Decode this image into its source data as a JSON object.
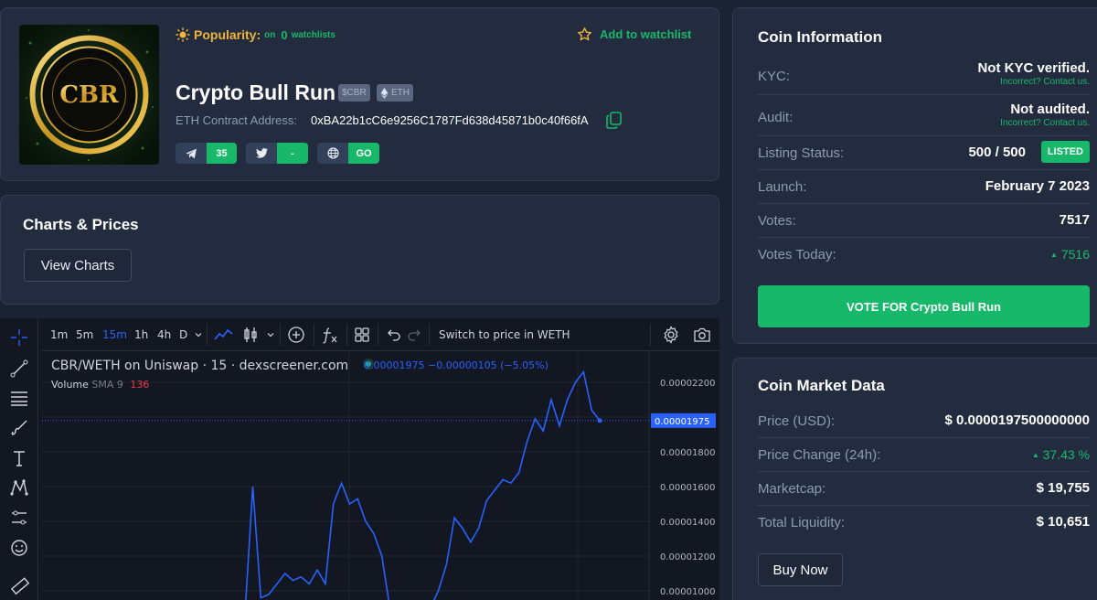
{
  "header": {
    "logo_text": "CBR",
    "logo_ring_text": "CRYPTO BULL RUN",
    "popularity_label": "Popularity:",
    "popularity_on": "on",
    "popularity_count": "0",
    "popularity_suffix": "watchlists",
    "watchlist_label": "Add to watchlist",
    "coin_name": "Crypto Bull Run",
    "symbol_tag": "$CBR",
    "chain_tag": "ETH",
    "contract_label": "ETH Contract Address:",
    "contract_address": "0xBA22b1cC6e9256C1787Fd638d45871b0c40f66fA",
    "socials": [
      {
        "icon": "telegram-icon",
        "value": "35"
      },
      {
        "icon": "twitter-icon",
        "value": "-"
      },
      {
        "icon": "globe-icon",
        "value": "GO"
      }
    ]
  },
  "charts_prices": {
    "title": "Charts & Prices",
    "button": "View Charts"
  },
  "chart_widget": {
    "intervals": [
      "1m",
      "5m",
      "15m",
      "1h",
      "4h",
      "D"
    ],
    "active_interval": "15m",
    "switch_label": "Switch to price in WETH",
    "symbol_line": "CBR/WETH on Uniswap · 15 · dexscreener.com",
    "price_line": "0.00001975 −0.00000105 (−5.05%)",
    "volume_label": "Volume",
    "volume_sma": "SMA 9",
    "volume_value": "136",
    "current_price_label": "0.00001975"
  },
  "chart_data": {
    "type": "line",
    "title": "CBR/WETH on Uniswap · 15 · dexscreener.com",
    "y_ticks": [
      "0.00002200",
      "0.00002000",
      "0.00001800",
      "0.00001600",
      "0.00001400",
      "0.00001200",
      "0.00001000"
    ],
    "ylim": [
      9.6e-06,
      2.32e-05
    ],
    "series": [
      {
        "values": [
          8e-06,
          8e-06,
          8e-06,
          1.6e-05,
          9.6e-06,
          9.8e-06,
          1.04e-05,
          1.1e-05,
          1.06e-05,
          1.08e-05,
          1.04e-05,
          1.12e-05,
          1.04e-05,
          1.5e-05,
          1.62e-05,
          1.5e-05,
          1.53e-05,
          1.4e-05,
          1.33e-05,
          1.2e-05,
          9e-06,
          8.5e-06,
          8e-06,
          8e-06,
          8e-06,
          9e-06,
          1e-05,
          1.15e-05,
          1.42e-05,
          1.36e-05,
          1.28e-05,
          1.36e-05,
          1.52e-05,
          1.58e-05,
          1.64e-05,
          1.62e-05,
          1.68e-05,
          1.86e-05,
          1.99e-05,
          1.92e-05,
          2.1e-05,
          1.95e-05,
          2.1e-05,
          2.2e-05,
          2.26e-05,
          2.04e-05,
          1.98e-05
        ]
      }
    ],
    "line_color": "#2962ff",
    "grid": true
  },
  "coin_info": {
    "title": "Coin Information",
    "rows": [
      {
        "key": "KYC:",
        "value": "Not KYC verified.",
        "sub": "Incorrect? Contact us."
      },
      {
        "key": "Audit:",
        "value": "Not audited.",
        "sub": "Incorrect? Contact us."
      },
      {
        "key": "Listing Status:",
        "value": "500 / 500",
        "badge": "LISTED"
      },
      {
        "key": "Launch:",
        "value": "February 7 2023"
      },
      {
        "key": "Votes:",
        "value": "7517"
      },
      {
        "key": "Votes Today:",
        "value": "7516"
      }
    ],
    "vote_button": "VOTE FOR Crypto Bull Run"
  },
  "market_data": {
    "title": "Coin Market Data",
    "rows": [
      {
        "key": "Price (USD):",
        "value": "$ 0.0000197500000000"
      },
      {
        "key": "Price Change (24h):",
        "value": "37.43 %"
      },
      {
        "key": "Marketcap:",
        "value": "$ 19,755"
      },
      {
        "key": "Total Liquidity:",
        "value": "$ 10,651"
      }
    ],
    "buy_button": "Buy Now"
  },
  "colors": {
    "accent_green": "#18b86a",
    "gold": "#f0b43a",
    "chart_line": "#2962ff"
  }
}
